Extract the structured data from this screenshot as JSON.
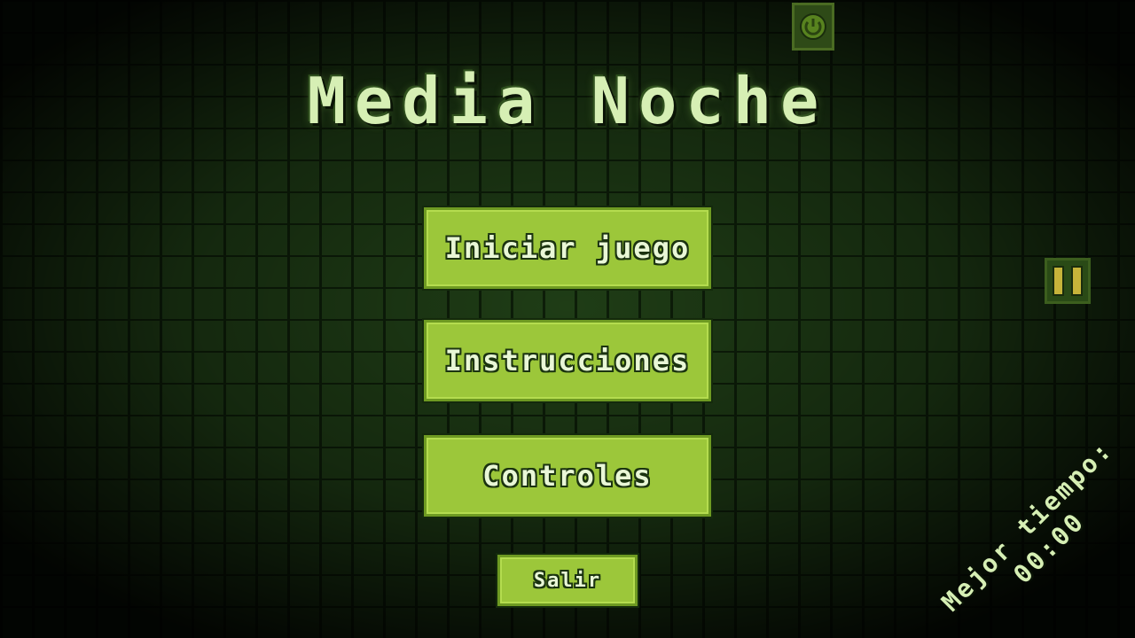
{
  "game": {
    "title": "Media Noche"
  },
  "menu": {
    "start_label": "Iniciar juego",
    "instructions_label": "Instrucciones",
    "controls_label": "Controles",
    "exit_label": "Salir"
  },
  "hud": {
    "best_time_label": "Mejor tiempo:",
    "best_time_value": "00:00",
    "power_icon": "power-icon",
    "pause_icon": "pause-icon"
  },
  "colors": {
    "button_fill": "#9cc73a",
    "title_text": "#d6efb4",
    "wall": "#1f3d16"
  }
}
